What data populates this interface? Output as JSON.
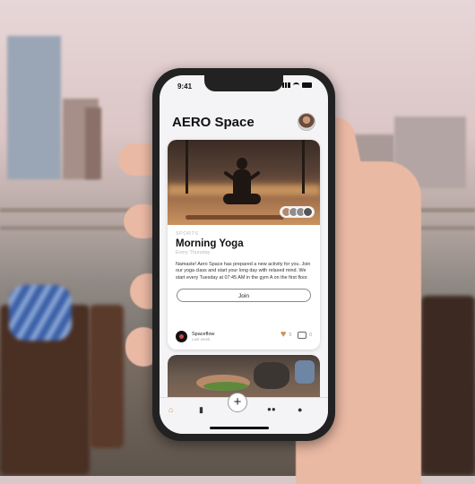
{
  "status_bar": {
    "time": "9:41"
  },
  "app": {
    "title": "AERO Space"
  },
  "card": {
    "category": "SPORTS",
    "title": "Morning Yoga",
    "subtitle": "Every Thursday",
    "description": "Namaste! Aero Space has prepared a new activity for you. Join our yoga class and start your long day with relaxed mind. We start every Tuesday at 07:45 AM in the gym A on the first floor.",
    "join_label": "Join",
    "organizer": "Spaceflow",
    "posted": "Last week",
    "likes": "5",
    "comments": "0"
  },
  "tabbar": {
    "items": [
      {
        "icon": "home-icon",
        "glyph": "⌂",
        "active": true
      },
      {
        "icon": "bookmark-icon",
        "glyph": "▮",
        "active": false
      },
      {
        "icon": "plus-icon",
        "glyph": "+",
        "active": false
      },
      {
        "icon": "people-icon",
        "glyph": "👥",
        "active": false
      },
      {
        "icon": "chat-icon",
        "glyph": "●",
        "active": false
      }
    ]
  },
  "colors": {
    "accent": "#d59a5b",
    "heart": "#c8905c",
    "background": "#f4f4f6"
  }
}
